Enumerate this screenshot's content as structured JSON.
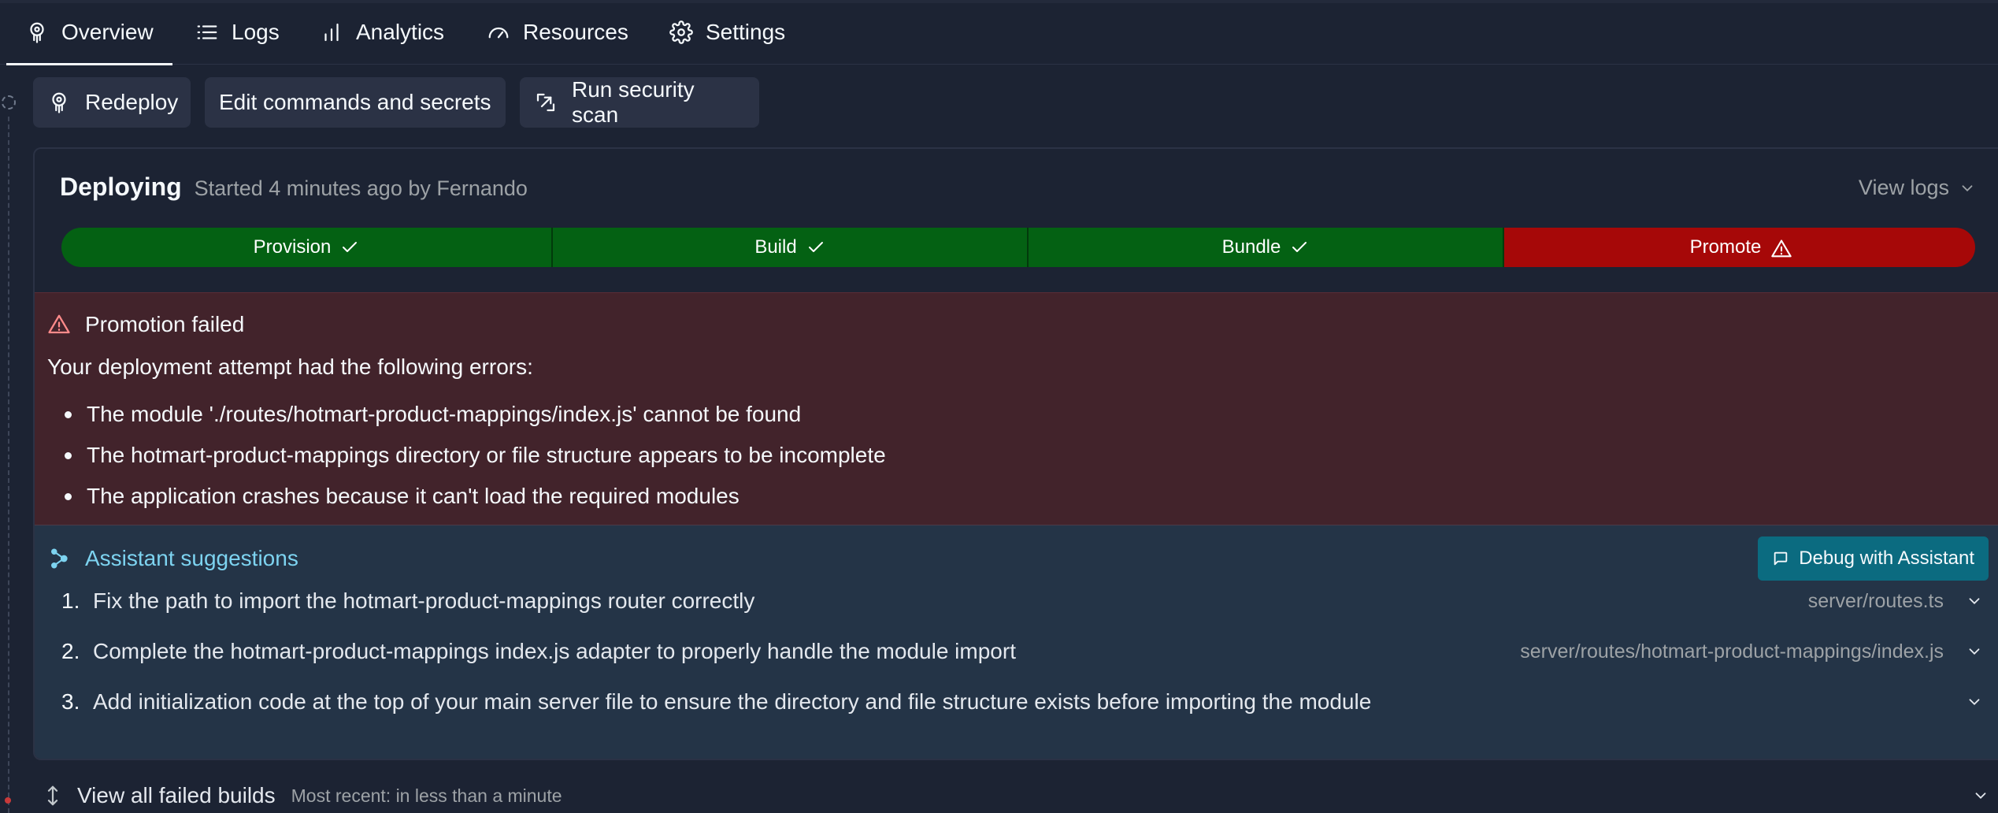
{
  "tabs": [
    {
      "label": "Overview",
      "icon": "rocket-icon",
      "active": true
    },
    {
      "label": "Logs",
      "icon": "list-icon"
    },
    {
      "label": "Analytics",
      "icon": "bar-chart-icon"
    },
    {
      "label": "Resources",
      "icon": "gauge-icon"
    },
    {
      "label": "Settings",
      "icon": "gear-icon"
    }
  ],
  "actions": {
    "redeploy": "Redeploy",
    "edit": "Edit commands and secrets",
    "scan": "Run security scan"
  },
  "deploy": {
    "title": "Deploying",
    "subtitle": "Started 4 minutes ago by Fernando",
    "view_logs": "View logs",
    "stages": [
      {
        "label": "Provision",
        "status": "success"
      },
      {
        "label": "Build",
        "status": "success"
      },
      {
        "label": "Bundle",
        "status": "success"
      },
      {
        "label": "Promote",
        "status": "failed"
      }
    ]
  },
  "error": {
    "title": "Promotion failed",
    "description": "Your deployment attempt had the following errors:",
    "items": [
      "The module './routes/hotmart-product-mappings/index.js' cannot be found",
      "The hotmart-product-mappings directory or file structure appears to be incomplete",
      "The application crashes because it can't load the required modules"
    ]
  },
  "assistant": {
    "title": "Assistant suggestions",
    "debug_button": "Debug with Assistant",
    "suggestions": [
      {
        "num": "1.",
        "text": "Fix the path to import the hotmart-product-mappings router correctly",
        "file": "server/routes.ts"
      },
      {
        "num": "2.",
        "text": "Complete the hotmart-product-mappings index.js adapter to properly handle the module import",
        "file": "server/routes/hotmart-product-mappings/index.js"
      },
      {
        "num": "3.",
        "text": "Add initialization code at the top of your main server file to ensure the directory and file structure exists before importing the module",
        "file": ""
      }
    ]
  },
  "failed_builds": {
    "label": "View all failed builds",
    "sub": "Most recent: in less than a minute"
  },
  "colors": {
    "background": "#1c2333",
    "stage_success": "#046113",
    "stage_failed": "#a60808",
    "error_panel": "#42232b",
    "assistant_panel": "#243447",
    "assistant_accent": "#7dd3f0",
    "debug_button": "#0b6b80"
  }
}
